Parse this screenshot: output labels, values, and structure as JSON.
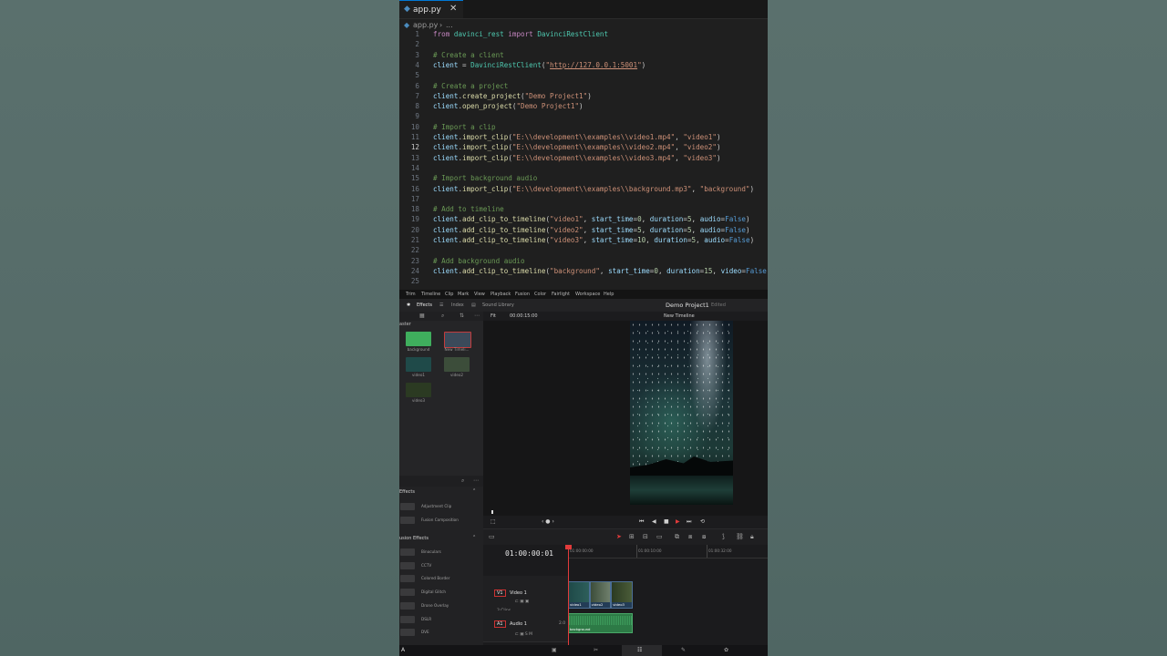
{
  "editor": {
    "tab": {
      "name": "app.py",
      "close": "✕"
    },
    "breadcrumb": {
      "file": "app.py",
      "sep": "›",
      "rest": "..."
    },
    "lines": [
      {
        "n": "1",
        "html": "<span class='kw'>from</span> <span class='cl'>davinci_rest</span> <span class='kw'>import</span> <span class='cl'>DavinciRestClient</span>"
      },
      {
        "n": "2",
        "html": ""
      },
      {
        "n": "3",
        "html": "<span class='cm'># Create a client</span>"
      },
      {
        "n": "4",
        "html": "<span class='vr'>client</span> = <span class='cl'>DavinciRestClient</span>(<span class='st'>\"<span class='ul'>http://127.0.0.1:5001</span>\"</span>)"
      },
      {
        "n": "5",
        "html": ""
      },
      {
        "n": "6",
        "html": "<span class='cm'># Create a project</span>"
      },
      {
        "n": "7",
        "html": "<span class='vr'>client</span>.<span class='fn'>create_project</span>(<span class='st'>\"Demo Project1\"</span>)"
      },
      {
        "n": "8",
        "html": "<span class='vr'>client</span>.<span class='fn'>open_project</span>(<span class='st'>\"Demo Project1\"</span>)"
      },
      {
        "n": "9",
        "html": ""
      },
      {
        "n": "10",
        "html": "<span class='cm'># Import a clip</span>"
      },
      {
        "n": "11",
        "html": "<span class='vr'>client</span>.<span class='fn'>import_clip</span>(<span class='st'>\"E:\\\\development\\\\examples\\\\video1.mp4\"</span>, <span class='st'>\"video1\"</span>)"
      },
      {
        "n": "12",
        "html": "<span class='vr'>client</span>.<span class='fn'>import_clip</span>(<span class='st'>\"E:\\\\development\\\\examples\\\\video2.mp4\"</span>, <span class='st'>\"video2\"</span>)"
      },
      {
        "n": "13",
        "html": "<span class='vr'>client</span>.<span class='fn'>import_clip</span>(<span class='st'>\"E:\\\\development\\\\examples\\\\video3.mp4\"</span>, <span class='st'>\"video3\"</span>)"
      },
      {
        "n": "14",
        "html": ""
      },
      {
        "n": "15",
        "html": "<span class='cm'># Import background audio</span>"
      },
      {
        "n": "16",
        "html": "<span class='vr'>client</span>.<span class='fn'>import_clip</span>(<span class='st'>\"E:\\\\development\\\\examples\\\\background.mp3\"</span>, <span class='st'>\"background\"</span>)"
      },
      {
        "n": "17",
        "html": ""
      },
      {
        "n": "18",
        "html": "<span class='cm'># Add to timeline</span>"
      },
      {
        "n": "19",
        "html": "<span class='vr'>client</span>.<span class='fn'>add_clip_to_timeline</span>(<span class='st'>\"video1\"</span>, <span class='vr'>start_time</span>=<span class='nm'>0</span>, <span class='vr'>duration</span>=<span class='nm'>5</span>, <span class='vr'>audio</span>=<span class='bo'>False</span>)"
      },
      {
        "n": "20",
        "html": "<span class='vr'>client</span>.<span class='fn'>add_clip_to_timeline</span>(<span class='st'>\"video2\"</span>, <span class='vr'>start_time</span>=<span class='nm'>5</span>, <span class='vr'>duration</span>=<span class='nm'>5</span>, <span class='vr'>audio</span>=<span class='bo'>False</span>)"
      },
      {
        "n": "21",
        "html": "<span class='vr'>client</span>.<span class='fn'>add_clip_to_timeline</span>(<span class='st'>\"video3\"</span>, <span class='vr'>start_time</span>=<span class='nm'>10</span>, <span class='vr'>duration</span>=<span class='nm'>5</span>, <span class='vr'>audio</span>=<span class='bo'>False</span>)"
      },
      {
        "n": "22",
        "html": ""
      },
      {
        "n": "23",
        "html": "<span class='cm'># Add background audio</span>"
      },
      {
        "n": "24",
        "html": "<span class='vr'>client</span>.<span class='fn'>add_clip_to_timeline</span>(<span class='st'>\"background\"</span>, <span class='vr'>start_time</span>=<span class='nm'>0</span>, <span class='vr'>duration</span>=<span class='nm'>15</span>, <span class='vr'>video</span>=<span class='bo'>False</span>"
      },
      {
        "n": "25",
        "html": ""
      }
    ],
    "current_line": "12"
  },
  "resolve": {
    "menu": [
      "Trim",
      "Timeline",
      "Clip",
      "Mark",
      "View",
      "Playback",
      "Fusion",
      "Color",
      "Fairlight",
      "Workspace",
      "Help"
    ],
    "toolbar": {
      "effects": "Effects",
      "index": "Index",
      "sound_library": "Sound Library"
    },
    "project": {
      "title": "Demo Project1",
      "status": "Edited"
    },
    "mediapool": {
      "label": "aster",
      "clips": [
        {
          "name": "background",
          "color": "#3fae5d"
        },
        {
          "name": "New Timeli...",
          "color": "#3b4a5a"
        },
        {
          "name": "video1",
          "color": "#1f4a49"
        },
        {
          "name": "video2",
          "color": "#3c4d3a"
        },
        {
          "name": "video3",
          "color": "#2b3a22"
        }
      ]
    },
    "viewer": {
      "fit": "Fit",
      "timecode": "00:00:15:00",
      "timeline_name": "New Timeline"
    },
    "effects": {
      "header1": "Effects",
      "items1": [
        "Adjustment Clip",
        "Fusion Composition"
      ],
      "header2": "usion Effects",
      "items2": [
        "Binoculars",
        "CCTV",
        "Colored Border",
        "Digital Glitch",
        "Drone Overlay",
        "DSLR",
        "DVE"
      ]
    },
    "timeline": {
      "timecode": "01:00:00:01",
      "ruler": [
        "01:00:00:00",
        "01:00:10:00",
        "01:00:32:00"
      ],
      "v1": {
        "id": "V1",
        "name": "Video 1",
        "count": "3 Clips"
      },
      "a1": {
        "id": "A1",
        "name": "Audio 1",
        "level": "2.0"
      },
      "video_clips": [
        "video1",
        "video2",
        "video3"
      ],
      "audio_clip": "background"
    },
    "bottom_label": "A"
  }
}
